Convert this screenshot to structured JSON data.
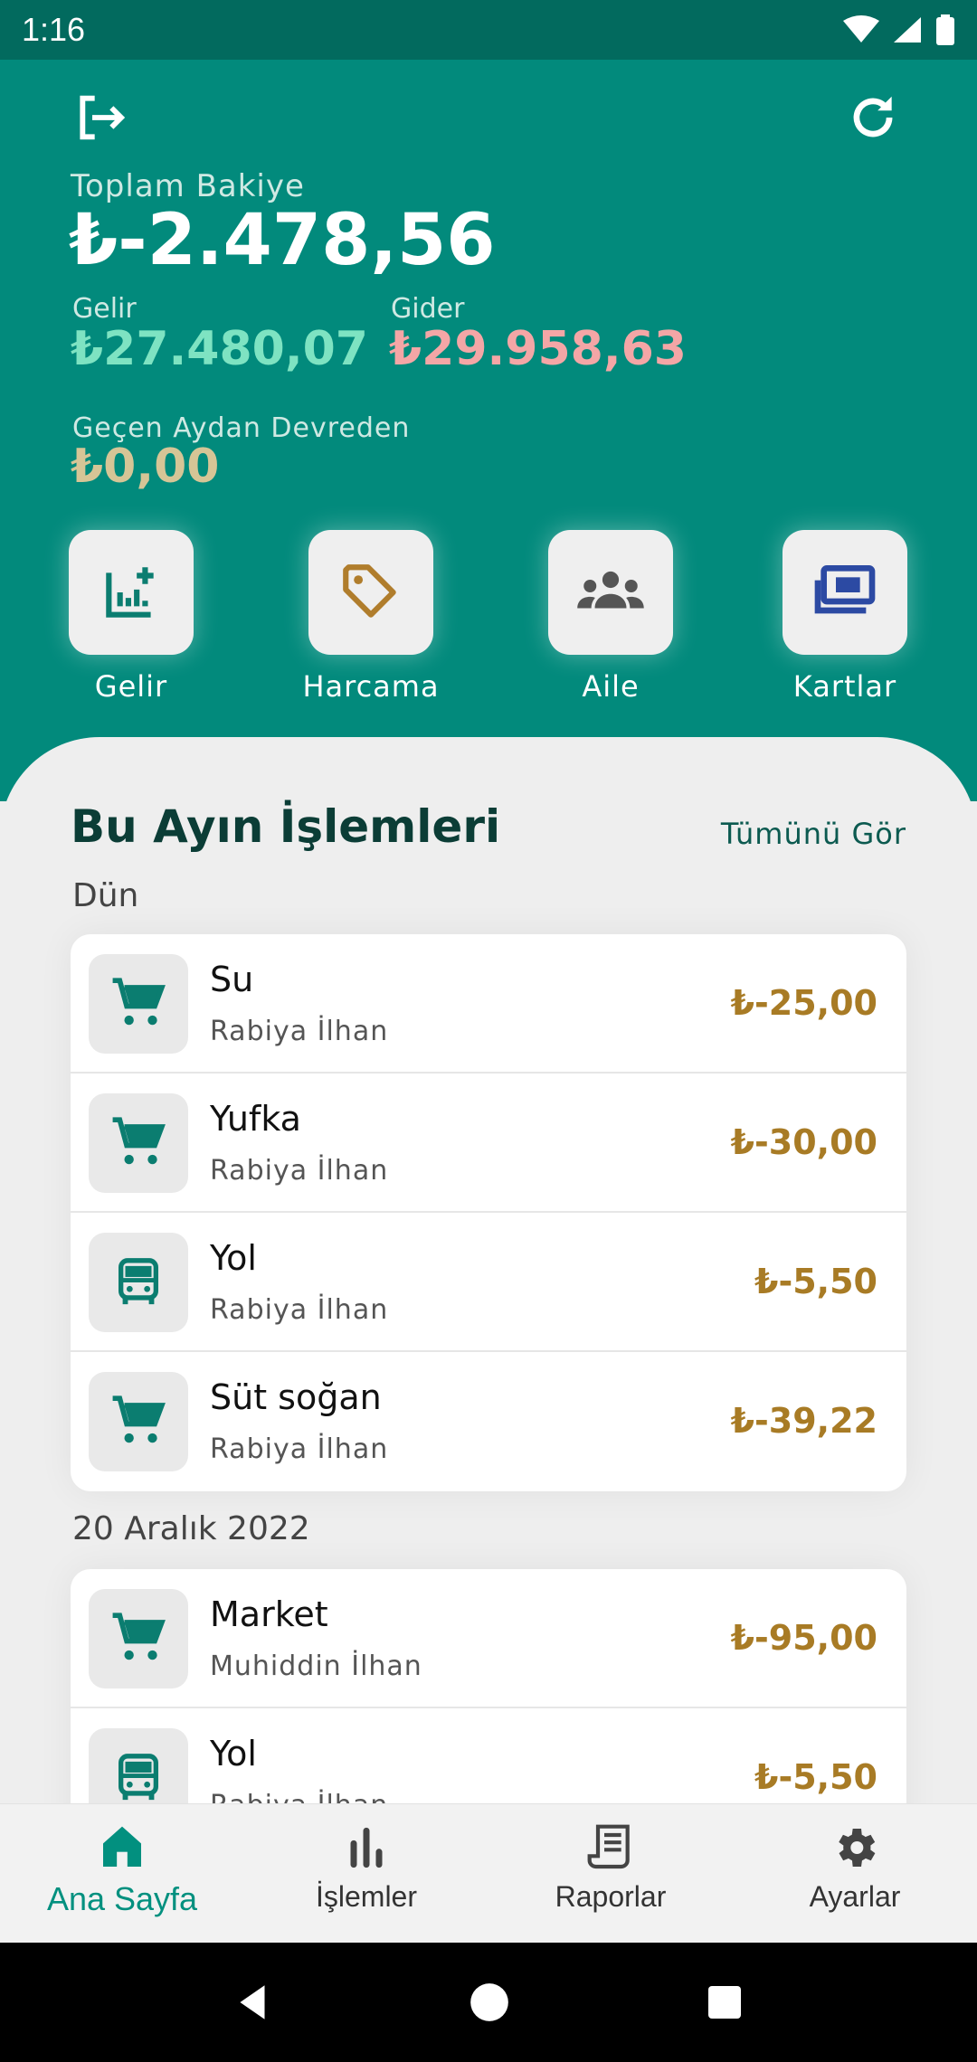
{
  "status": {
    "time": "1:16"
  },
  "header": {
    "balance_label": "Toplam Bakiye",
    "balance_value": "₺-2.478,56",
    "income_label": "Gelir",
    "income_value": "₺27.480,07",
    "expense_label": "Gider",
    "expense_value": "₺29.958,63",
    "carry_label": "Geçen Aydan Devreden",
    "carry_value": "₺0,00"
  },
  "quick_actions": [
    {
      "label": "Gelir",
      "icon": "add-chart-icon"
    },
    {
      "label": "Harcama",
      "icon": "tag-icon"
    },
    {
      "label": "Aile",
      "icon": "family-icon"
    },
    {
      "label": "Kartlar",
      "icon": "cards-icon"
    }
  ],
  "transactions": {
    "title": "Bu Ayın İşlemleri",
    "see_all": "Tümünü Gör",
    "groups": [
      {
        "label": "Dün",
        "items": [
          {
            "title": "Su",
            "person": "Rabiya İlhan",
            "amount": "₺-25,00",
            "icon": "cart-icon"
          },
          {
            "title": "Yufka",
            "person": "Rabiya İlhan",
            "amount": "₺-30,00",
            "icon": "cart-icon"
          },
          {
            "title": "Yol",
            "person": "Rabiya İlhan",
            "amount": "₺-5,50",
            "icon": "bus-icon"
          },
          {
            "title": "Süt soğan",
            "person": "Rabiya İlhan",
            "amount": "₺-39,22",
            "icon": "cart-icon"
          }
        ]
      },
      {
        "label": "20 Aralık 2022",
        "items": [
          {
            "title": "Market",
            "person": "Muhiddin İlhan",
            "amount": "₺-95,00",
            "icon": "cart-icon"
          },
          {
            "title": "Yol",
            "person": "Rabiya İlhan",
            "amount": "₺-5,50",
            "icon": "bus-icon"
          }
        ]
      }
    ]
  },
  "nav": [
    {
      "label": "Ana Sayfa",
      "icon": "home-icon",
      "active": true
    },
    {
      "label": "İşlemler",
      "icon": "bar-chart-icon",
      "active": false
    },
    {
      "label": "Raporlar",
      "icon": "receipt-icon",
      "active": false
    },
    {
      "label": "Ayarlar",
      "icon": "gear-icon",
      "active": false
    }
  ],
  "colors": {
    "header_bg": "#028a7c",
    "income": "#7ee3c2",
    "expense": "#f4a6a6",
    "carry": "#d6c596",
    "amount": "#a87b25",
    "accent": "#02907f"
  }
}
